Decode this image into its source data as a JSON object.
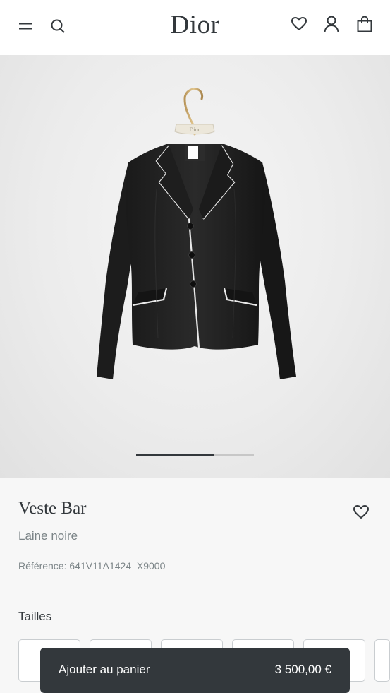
{
  "header": {
    "logo": "Dior",
    "icons": [
      "menu-icon",
      "search-icon",
      "heart-icon",
      "user-icon",
      "bag-icon"
    ]
  },
  "gallery": {
    "hanger_tag": "Dior",
    "progress": 0.66
  },
  "product": {
    "title": "Veste Bar",
    "subtitle": "Laine noire",
    "reference": "Référence: 641V11A1424_X9000"
  },
  "sizes": {
    "label": "Tailles",
    "options": [
      "",
      "",
      "",
      "",
      "",
      ""
    ]
  },
  "cart": {
    "label": "Ajouter au panier",
    "price": "3 500,00 €"
  },
  "colors": {
    "text": "#33383c",
    "muted": "#7b8487",
    "button": "#33383c"
  }
}
